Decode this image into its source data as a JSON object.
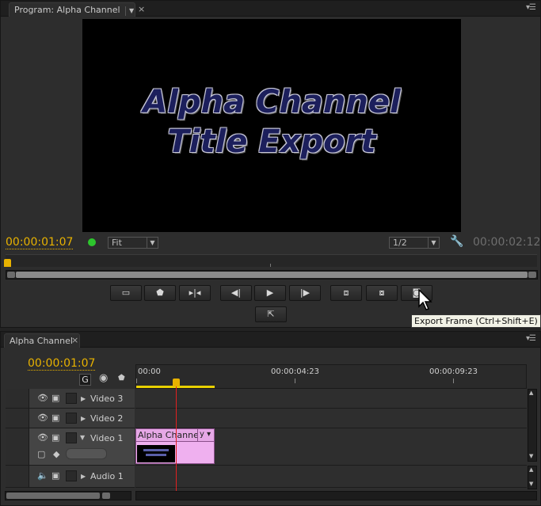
{
  "program_monitor": {
    "tab_label": "Program: Alpha Channel",
    "close_label": "×",
    "menu_icon": "panel-menu-icon",
    "title_lines": [
      "Alpha Channel",
      "Title Export"
    ],
    "current_timecode": "00:00:01:07",
    "fit_label": "Fit",
    "resolution_label": "1/2",
    "duration_timecode": "00:00:02:12",
    "tooltip": "Export Frame (Ctrl+Shift+E)"
  },
  "timeline": {
    "tab_label": "Alpha Channel",
    "close_label": "×",
    "current_timecode": "00:00:01:07",
    "ruler_labels": [
      "00:00",
      "00:00:04:23",
      "00:00:09:23"
    ],
    "tracks": [
      {
        "name": "Video 3"
      },
      {
        "name": "Video 2"
      },
      {
        "name": "Video 1"
      },
      {
        "name": "Audio 1"
      }
    ],
    "clip_label": "Alpha Channel",
    "clip_suffix": "y"
  },
  "colors": {
    "timecode_active": "#e8b200",
    "clip": "#efb0ef",
    "playhead_line": "#e02020"
  }
}
